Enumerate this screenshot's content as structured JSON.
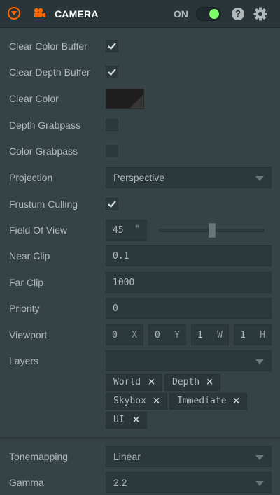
{
  "header": {
    "title": "CAMERA",
    "toggle_label": "ON",
    "toggle_on": true,
    "help_icon_text": "?",
    "icons": [
      "collapse-icon",
      "camera-icon",
      "help-icon",
      "gear-icon"
    ],
    "accent_color": "#ff6600",
    "toggle_color": "#7cfc69"
  },
  "fields": {
    "clear_color_buffer": {
      "label": "Clear Color Buffer",
      "checked": true
    },
    "clear_depth_buffer": {
      "label": "Clear Depth Buffer",
      "checked": true
    },
    "clear_color": {
      "label": "Clear Color",
      "color": "#1e1e1e"
    },
    "depth_grabpass": {
      "label": "Depth Grabpass",
      "checked": false
    },
    "color_grabpass": {
      "label": "Color Grabpass",
      "checked": false
    },
    "projection": {
      "label": "Projection",
      "value": "Perspective"
    },
    "frustum_culling": {
      "label": "Frustum Culling",
      "checked": true
    },
    "field_of_view": {
      "label": "Field Of View",
      "value": "45",
      "unit": "°",
      "slider_fraction": 0.5
    },
    "near_clip": {
      "label": "Near Clip",
      "value": "0.1"
    },
    "far_clip": {
      "label": "Far Clip",
      "value": "1000"
    },
    "priority": {
      "label": "Priority",
      "value": "0"
    },
    "viewport": {
      "label": "Viewport",
      "values": [
        {
          "value": "0",
          "axis": "X"
        },
        {
          "value": "0",
          "axis": "Y"
        },
        {
          "value": "1",
          "axis": "W"
        },
        {
          "value": "1",
          "axis": "H"
        }
      ]
    },
    "layers": {
      "label": "Layers",
      "tags": [
        "World",
        "Depth",
        "Skybox",
        "Immediate",
        "UI"
      ],
      "remove_glyph": "×"
    },
    "tonemapping": {
      "label": "Tonemapping",
      "value": "Linear"
    },
    "gamma": {
      "label": "Gamma",
      "value": "2.2"
    }
  }
}
